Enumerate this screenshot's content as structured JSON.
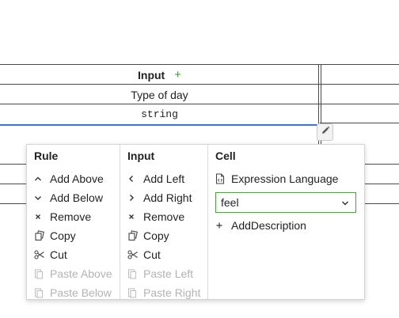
{
  "table": {
    "header_label": "Input",
    "type_label": "Type of day",
    "type_ref": "string"
  },
  "context_menu": {
    "rule": {
      "title": "Rule",
      "items": [
        {
          "label": "Add Above",
          "icon": "chevron-up-icon",
          "enabled": true
        },
        {
          "label": "Add Below",
          "icon": "chevron-down-icon",
          "enabled": true
        },
        {
          "label": "Remove",
          "icon": "close-icon",
          "enabled": true
        },
        {
          "label": "Copy",
          "icon": "copy-icon",
          "enabled": true
        },
        {
          "label": "Cut",
          "icon": "scissors-icon",
          "enabled": true
        },
        {
          "label": "Paste Above",
          "icon": "paste-icon",
          "enabled": false
        },
        {
          "label": "Paste Below",
          "icon": "paste-icon",
          "enabled": false
        }
      ]
    },
    "input": {
      "title": "Input",
      "items": [
        {
          "label": "Add Left",
          "icon": "chevron-left-icon",
          "enabled": true
        },
        {
          "label": "Add Right",
          "icon": "chevron-right-icon",
          "enabled": true
        },
        {
          "label": "Remove",
          "icon": "close-icon",
          "enabled": true
        },
        {
          "label": "Copy",
          "icon": "copy-icon",
          "enabled": true
        },
        {
          "label": "Cut",
          "icon": "scissors-icon",
          "enabled": true
        },
        {
          "label": "Paste Left",
          "icon": "paste-icon",
          "enabled": false
        },
        {
          "label": "Paste Right",
          "icon": "paste-icon",
          "enabled": false
        }
      ]
    },
    "cell": {
      "title": "Cell",
      "expression_language_label": "Expression Language",
      "expression_language_value": "feel",
      "add_description_label": "AddDescription"
    }
  },
  "colors": {
    "accent_green": "#4a9e3e",
    "selection_blue": "#3a73d6",
    "disabled_text": "#b3b3b3"
  }
}
